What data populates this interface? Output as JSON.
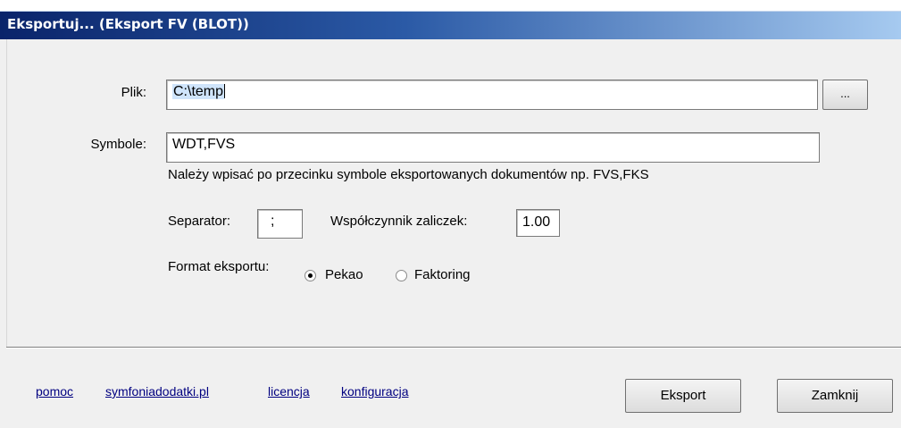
{
  "window": {
    "title": "Eksportuj... (Eksport FV (BLOT))"
  },
  "file": {
    "label": "Plik:",
    "value_selected": "C:\\temp",
    "browse_label": "..."
  },
  "symbols": {
    "label": "Symbole:",
    "value": "WDT,FVS",
    "hint": "Należy wpisać po przecinku symbole eksportowanych dokumentów np. FVS,FKS"
  },
  "separator": {
    "label": "Separator:",
    "value": ";"
  },
  "coefficient": {
    "label": "Współczynnik zaliczek:",
    "value": "1.00"
  },
  "format": {
    "label": "Format eksportu:",
    "options": [
      {
        "label": "Pekao",
        "selected": true
      },
      {
        "label": "Faktoring",
        "selected": false
      }
    ]
  },
  "links": [
    "pomoc",
    "symfoniadodatki.pl",
    "licencja",
    "konfiguracja"
  ],
  "buttons": {
    "export": "Eksport",
    "close": "Zamknij"
  }
}
